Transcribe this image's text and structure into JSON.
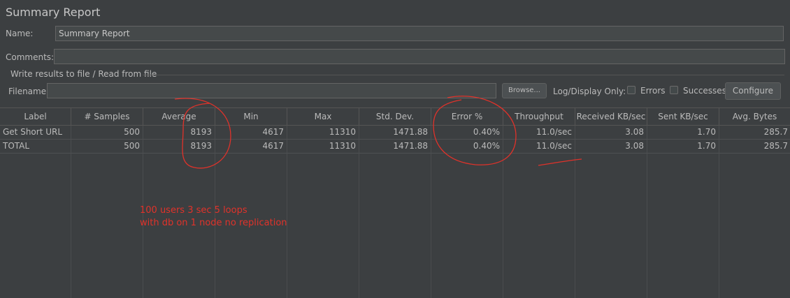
{
  "window": {
    "title": "Summary Report"
  },
  "form": {
    "name_label": "Name:",
    "name_value": "Summary Report",
    "comments_label": "Comments:",
    "comments_value": "",
    "group_title": "Write results to file / Read from file",
    "filename_label": "Filename",
    "filename_value": "",
    "browse_label": "Browse...",
    "log_display_label": "Log/Display Only:",
    "errors_label": "Errors",
    "errors_checked": false,
    "successes_label": "Successes",
    "successes_checked": false,
    "configure_label": "Configure"
  },
  "table": {
    "columns": [
      "Label",
      "# Samples",
      "Average",
      "Min",
      "Max",
      "Std. Dev.",
      "Error %",
      "Throughput",
      "Received KB/sec",
      "Sent KB/sec",
      "Avg. Bytes"
    ],
    "rows": [
      [
        "Get Short URL",
        "500",
        "8193",
        "4617",
        "11310",
        "1471.88",
        "0.40%",
        "11.0/sec",
        "3.08",
        "1.70",
        "285.7"
      ],
      [
        "TOTAL",
        "500",
        "8193",
        "4617",
        "11310",
        "1471.88",
        "0.40%",
        "11.0/sec",
        "3.08",
        "1.70",
        "285.7"
      ]
    ]
  },
  "annotation": {
    "line1": "100 users 3 sec 5 loops",
    "line2": "with db on 1 node no replication",
    "ink_color": "#e0322a"
  },
  "colors": {
    "background": "#3c3f41",
    "field": "#45494a",
    "text": "#bbbbbb"
  }
}
